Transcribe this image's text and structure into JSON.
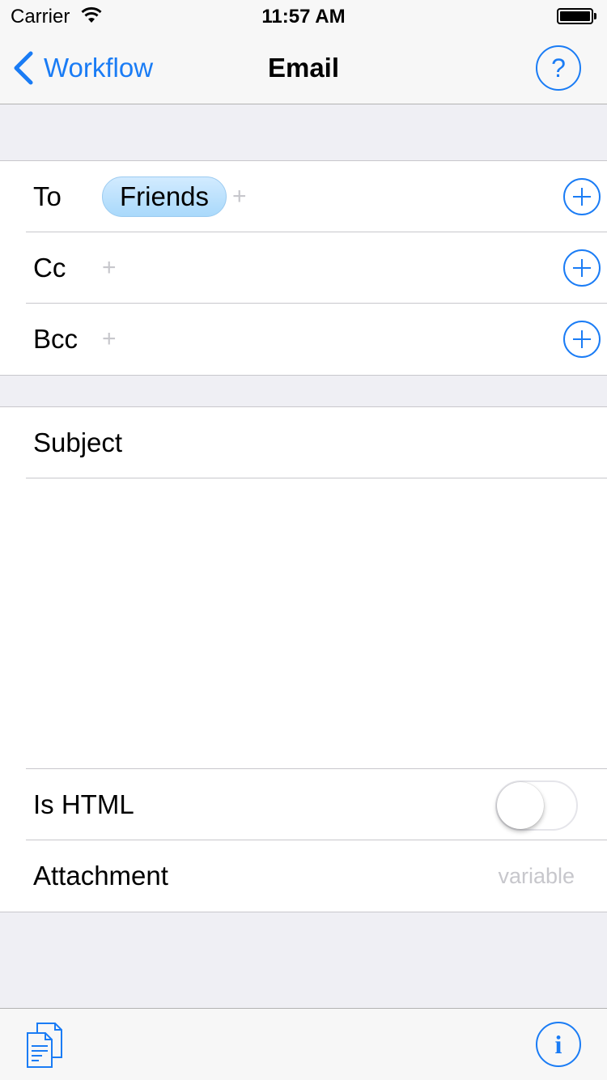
{
  "status_bar": {
    "carrier": "Carrier",
    "time": "11:57 AM",
    "wifi_icon": "wifi-icon",
    "battery_icon": "battery-full-icon"
  },
  "nav": {
    "back_label": "Workflow",
    "title": "Email",
    "help_symbol": "?",
    "accent_color": "#1a7cf5"
  },
  "recipients": {
    "to": {
      "label": "To",
      "tokens": [
        "Friends"
      ],
      "add_symbol": "+"
    },
    "cc": {
      "label": "Cc",
      "add_symbol": "+"
    },
    "bcc": {
      "label": "Bcc",
      "add_symbol": "+"
    }
  },
  "message": {
    "subject_label": "Subject",
    "body_value": ""
  },
  "options": {
    "is_html": {
      "label": "Is HTML",
      "on": false
    },
    "attachment": {
      "label": "Attachment",
      "placeholder": "variable"
    }
  },
  "toolbar": {
    "docs_icon": "documents-icon",
    "info_symbol": "i"
  }
}
